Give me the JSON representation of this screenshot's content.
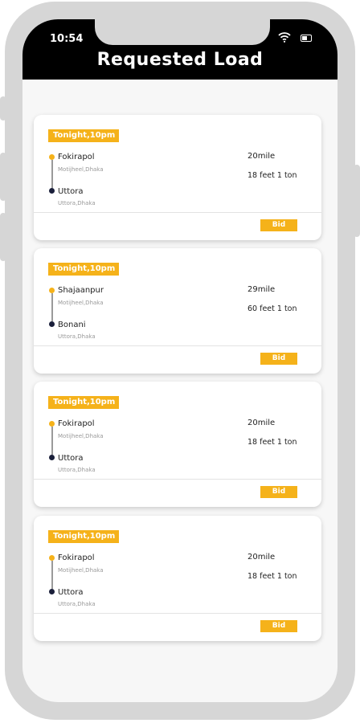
{
  "status_bar": {
    "time": "10:54"
  },
  "header": {
    "title": "Requested Load"
  },
  "loads": [
    {
      "tag": "Tonight,10pm",
      "from": "Fokirapol",
      "from_sub": "Motijheel,Dhaka",
      "to": "Uttora",
      "to_sub": "Uttora,Dhaka",
      "distance": "20mile",
      "size": "18 feet 1 ton",
      "action": "Bid"
    },
    {
      "tag": "Tonight,10pm",
      "from": "Shajaanpur",
      "from_sub": "Motijheel,Dhaka",
      "to": "Bonani",
      "to_sub": "Uttora,Dhaka",
      "distance": "29mile",
      "size": "60 feet 1 ton",
      "action": "Bid"
    },
    {
      "tag": "Tonight,10pm",
      "from": "Fokirapol",
      "from_sub": "Motijheel,Dhaka",
      "to": "Uttora",
      "to_sub": "Uttora,Dhaka",
      "distance": "20mile",
      "size": "18 feet 1 ton",
      "action": "Bid"
    },
    {
      "tag": "Tonight,10pm",
      "from": "Fokirapol",
      "from_sub": "Motijheel,Dhaka",
      "to": "Uttora",
      "to_sub": "Uttora,Dhaka",
      "distance": "20mile",
      "size": "18 feet 1 ton",
      "action": "Bid"
    }
  ],
  "colors": {
    "accent": "#f5b21a",
    "header_bg": "#000000",
    "destination_dot": "#1a1f3a"
  }
}
